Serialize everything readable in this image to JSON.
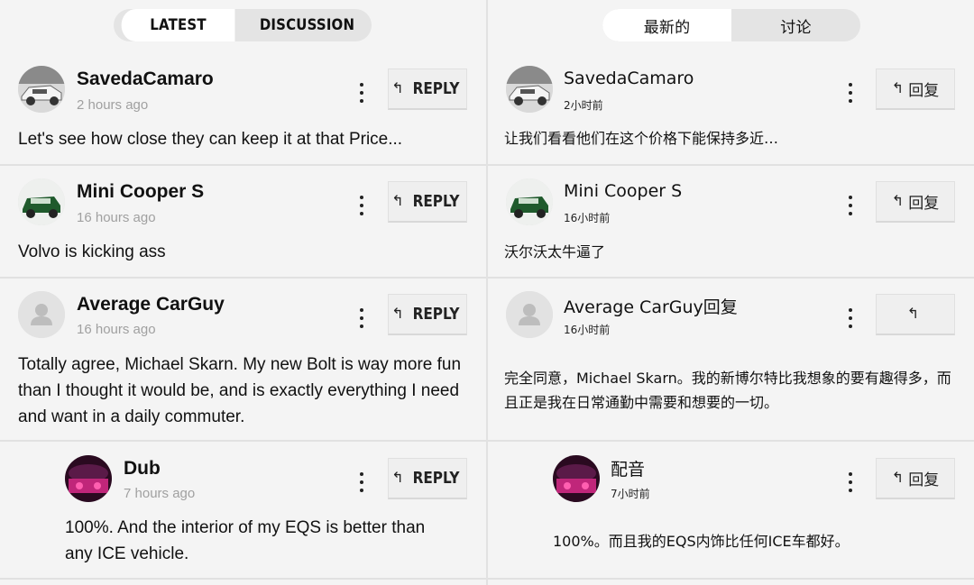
{
  "left": {
    "tabs": [
      "LATEST",
      "DISCUSSION"
    ],
    "reply_label": "REPLY",
    "comments": [
      {
        "author": "SavedaCamaro",
        "time": "2 hours ago",
        "text": "Let's see how close they can keep it at that Price..."
      },
      {
        "author": "Mini Cooper S",
        "time": "16 hours ago",
        "text": "Volvo is kicking ass"
      },
      {
        "author": "Average CarGuy",
        "time": "16 hours ago",
        "text": "Totally agree, Michael Skarn. My new Bolt is way more fun than I thought it would be, and is exactly everything I need and want in a daily commuter."
      },
      {
        "author": "Dub",
        "time": "7 hours ago",
        "text": "100%. And the interior of my EQS is better than any ICE vehicle."
      }
    ]
  },
  "right": {
    "tabs": [
      "最新的",
      "讨论"
    ],
    "reply_label": "回复",
    "comments": [
      {
        "author": "SavedaCamaro",
        "time": "2小时前",
        "text": "让我们看看他们在这个价格下能保持多近…",
        "reply": "回复"
      },
      {
        "author": "Mini Cooper S",
        "time": "16小时前",
        "text": "沃尔沃太牛逼了",
        "reply": "回复"
      },
      {
        "author": "Average CarGuy回复",
        "time": "16小时前",
        "text": "完全同意，Michael Skarn。我的新博尔特比我想象的要有趣得多，而且正是我在日常通勤中需要和想要的一切。",
        "reply": ""
      },
      {
        "author": "配音",
        "time": "7小时前",
        "text": "100%。而且我的EQS内饰比任何ICE车都好。",
        "reply": "回复"
      }
    ]
  },
  "icons": {
    "reply": "reply-arrow-icon",
    "more": "kebab-menu-icon",
    "avatars": [
      "camaro-car-photo",
      "green-mini-cooper-photo",
      "default-user-silhouette",
      "pink-car-interior-photo"
    ]
  },
  "colors": {
    "background": "#f4f4f4",
    "tab_active": "#ffffff",
    "tab_inactive": "#e4e4e4",
    "timestamp": "#a0a0a0"
  }
}
